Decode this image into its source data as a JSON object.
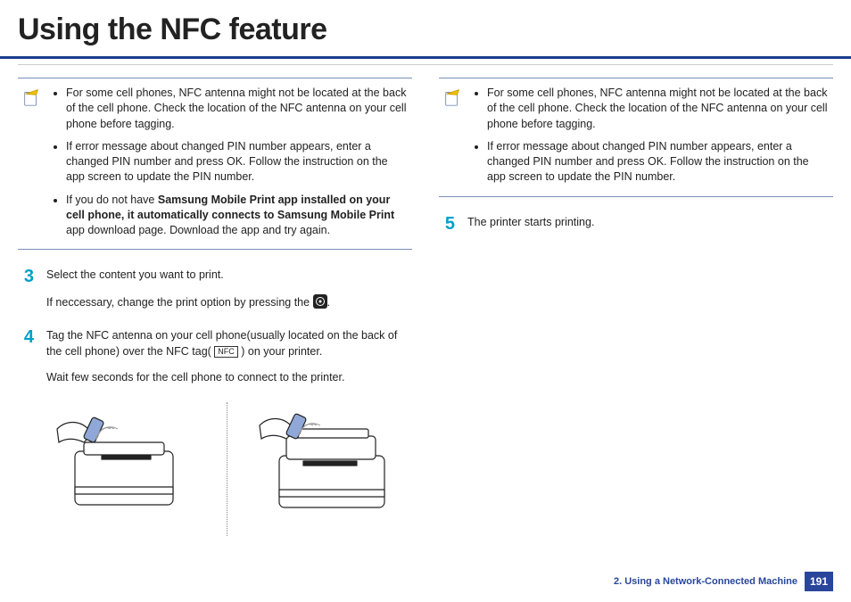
{
  "header_title": "Using the NFC feature",
  "col1": {
    "note_items": [
      "For some cell phones, NFC antenna might not be located at the back of the cell phone. Check the location of the NFC antenna on your cell phone before tagging.",
      "If error message about changed PIN number appears, enter a changed PIN number and press OK. Follow the instruction on the app screen to update the PIN number."
    ],
    "note_item3_pre": "If you do not have ",
    "note_item3_bold": "Samsung Mobile Print app installed on your cell phone, it automatically connects to Samsung Mobile Print",
    "note_item3_post": " app download page. Download the app and try again.",
    "step3_num": "3",
    "step3_p1": "Select the content you want to print.",
    "step3_p2_pre": "If neccessary, change the print option by pressing the ",
    "step3_p2_post": ".",
    "step4_num": "4",
    "step4_p1_pre": "Tag the NFC antenna on your cell phone(usually located on the back of the cell phone) over the NFC tag( ",
    "step4_nfc_label": "NFC",
    "step4_p1_post": " ) on your printer.",
    "step4_p2": "Wait few seconds for the cell phone to connect to the printer."
  },
  "col2": {
    "note_items": [
      "For some cell phones, NFC antenna might not be located at the back of the cell phone. Check the location of the NFC antenna on your cell phone before tagging.",
      "If error message about changed PIN number appears, enter a changed PIN number and press OK. Follow the instruction on the app screen to update the PIN number."
    ],
    "step5_num": "5",
    "step5_p1": "The printer starts printing."
  },
  "footer": {
    "chapter": "2.  Using a Network-Connected Machine",
    "page": "191"
  }
}
